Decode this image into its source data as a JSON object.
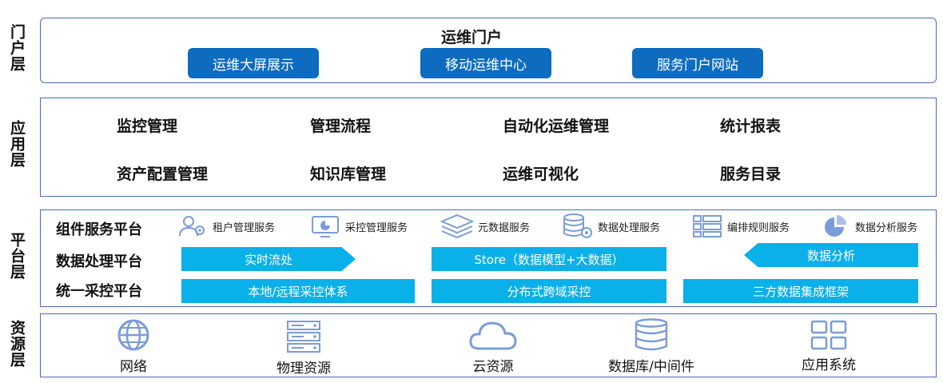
{
  "layers": {
    "portal": "门户层",
    "app": "应用层",
    "platform": "平台层",
    "resource": "资源层"
  },
  "portal": {
    "title": "运维门户",
    "buttons": [
      "运维大屏展示",
      "移动运维中心",
      "服务门户网站"
    ]
  },
  "app": {
    "items": [
      "监控管理",
      "管理流程",
      "自动化运维管理",
      "统计报表",
      "资产配置管理",
      "知识库管理",
      "运维可视化",
      "服务目录"
    ]
  },
  "platform": {
    "rows": [
      "组件服务平台",
      "数据处理平台",
      "统一采控平台"
    ],
    "services": [
      "租户管理服务",
      "采控管理服务",
      "元数据服务",
      "数据处理服务",
      "编排规则服务",
      "数据分析服务"
    ],
    "processing": [
      "实时流处",
      "Store（数据模型+大数据）",
      "数据分析"
    ],
    "collection": [
      "本地/远程采控体系",
      "分布式跨域采控",
      "三方数据集成框架"
    ]
  },
  "resource": {
    "items": [
      "网络",
      "物理资源",
      "云资源",
      "数据库/中间件",
      "应用系统"
    ]
  },
  "colors": {
    "border": "#4a6bb5",
    "dark_button": "#0d6cc0",
    "cyan_bar": "#0ab0ea",
    "icon": "#7b9cd8"
  }
}
